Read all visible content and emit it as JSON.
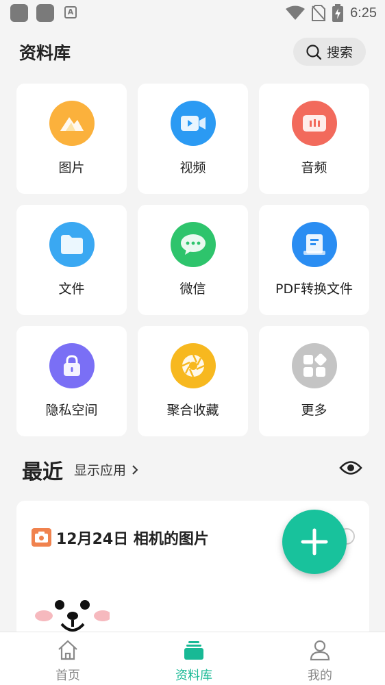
{
  "status_bar": {
    "time": "6:25",
    "icons": [
      "app-icon",
      "app-icon",
      "a-icon",
      "wifi-icon",
      "no-sim-icon",
      "battery-charging-icon"
    ]
  },
  "header": {
    "title": "资料库",
    "search_label": "搜索"
  },
  "categories": [
    {
      "label": "图片",
      "icon": "picture-icon",
      "color": "#fbb13c"
    },
    {
      "label": "视频",
      "icon": "video-icon",
      "color": "#2b9af3"
    },
    {
      "label": "音频",
      "icon": "audio-icon",
      "color": "#f26a5c"
    },
    {
      "label": "文件",
      "icon": "folder-icon",
      "color": "#3aa8f2"
    },
    {
      "label": "微信",
      "icon": "wechat-icon",
      "color": "#2ec46c"
    },
    {
      "label": "PDF转换文件",
      "icon": "pdf-icon",
      "color": "#2a8df2"
    },
    {
      "label": "隐私空间",
      "icon": "lock-icon",
      "color": "#7a6ff5"
    },
    {
      "label": "聚合收藏",
      "icon": "aperture-icon",
      "color": "#f7b81f"
    },
    {
      "label": "更多",
      "icon": "more-apps-icon",
      "color": "#c4c4c4"
    }
  ],
  "recent": {
    "title": "最近",
    "show_apps_label": "显示应用",
    "date_label": "12月24日 相机的图片"
  },
  "bottom_nav": [
    {
      "label": "首页",
      "icon": "home-icon",
      "active": false
    },
    {
      "label": "资料库",
      "icon": "library-icon",
      "active": true
    },
    {
      "label": "我的",
      "icon": "profile-icon",
      "active": false
    }
  ],
  "colors": {
    "accent": "#18c29c",
    "background": "#f4f4f4"
  }
}
